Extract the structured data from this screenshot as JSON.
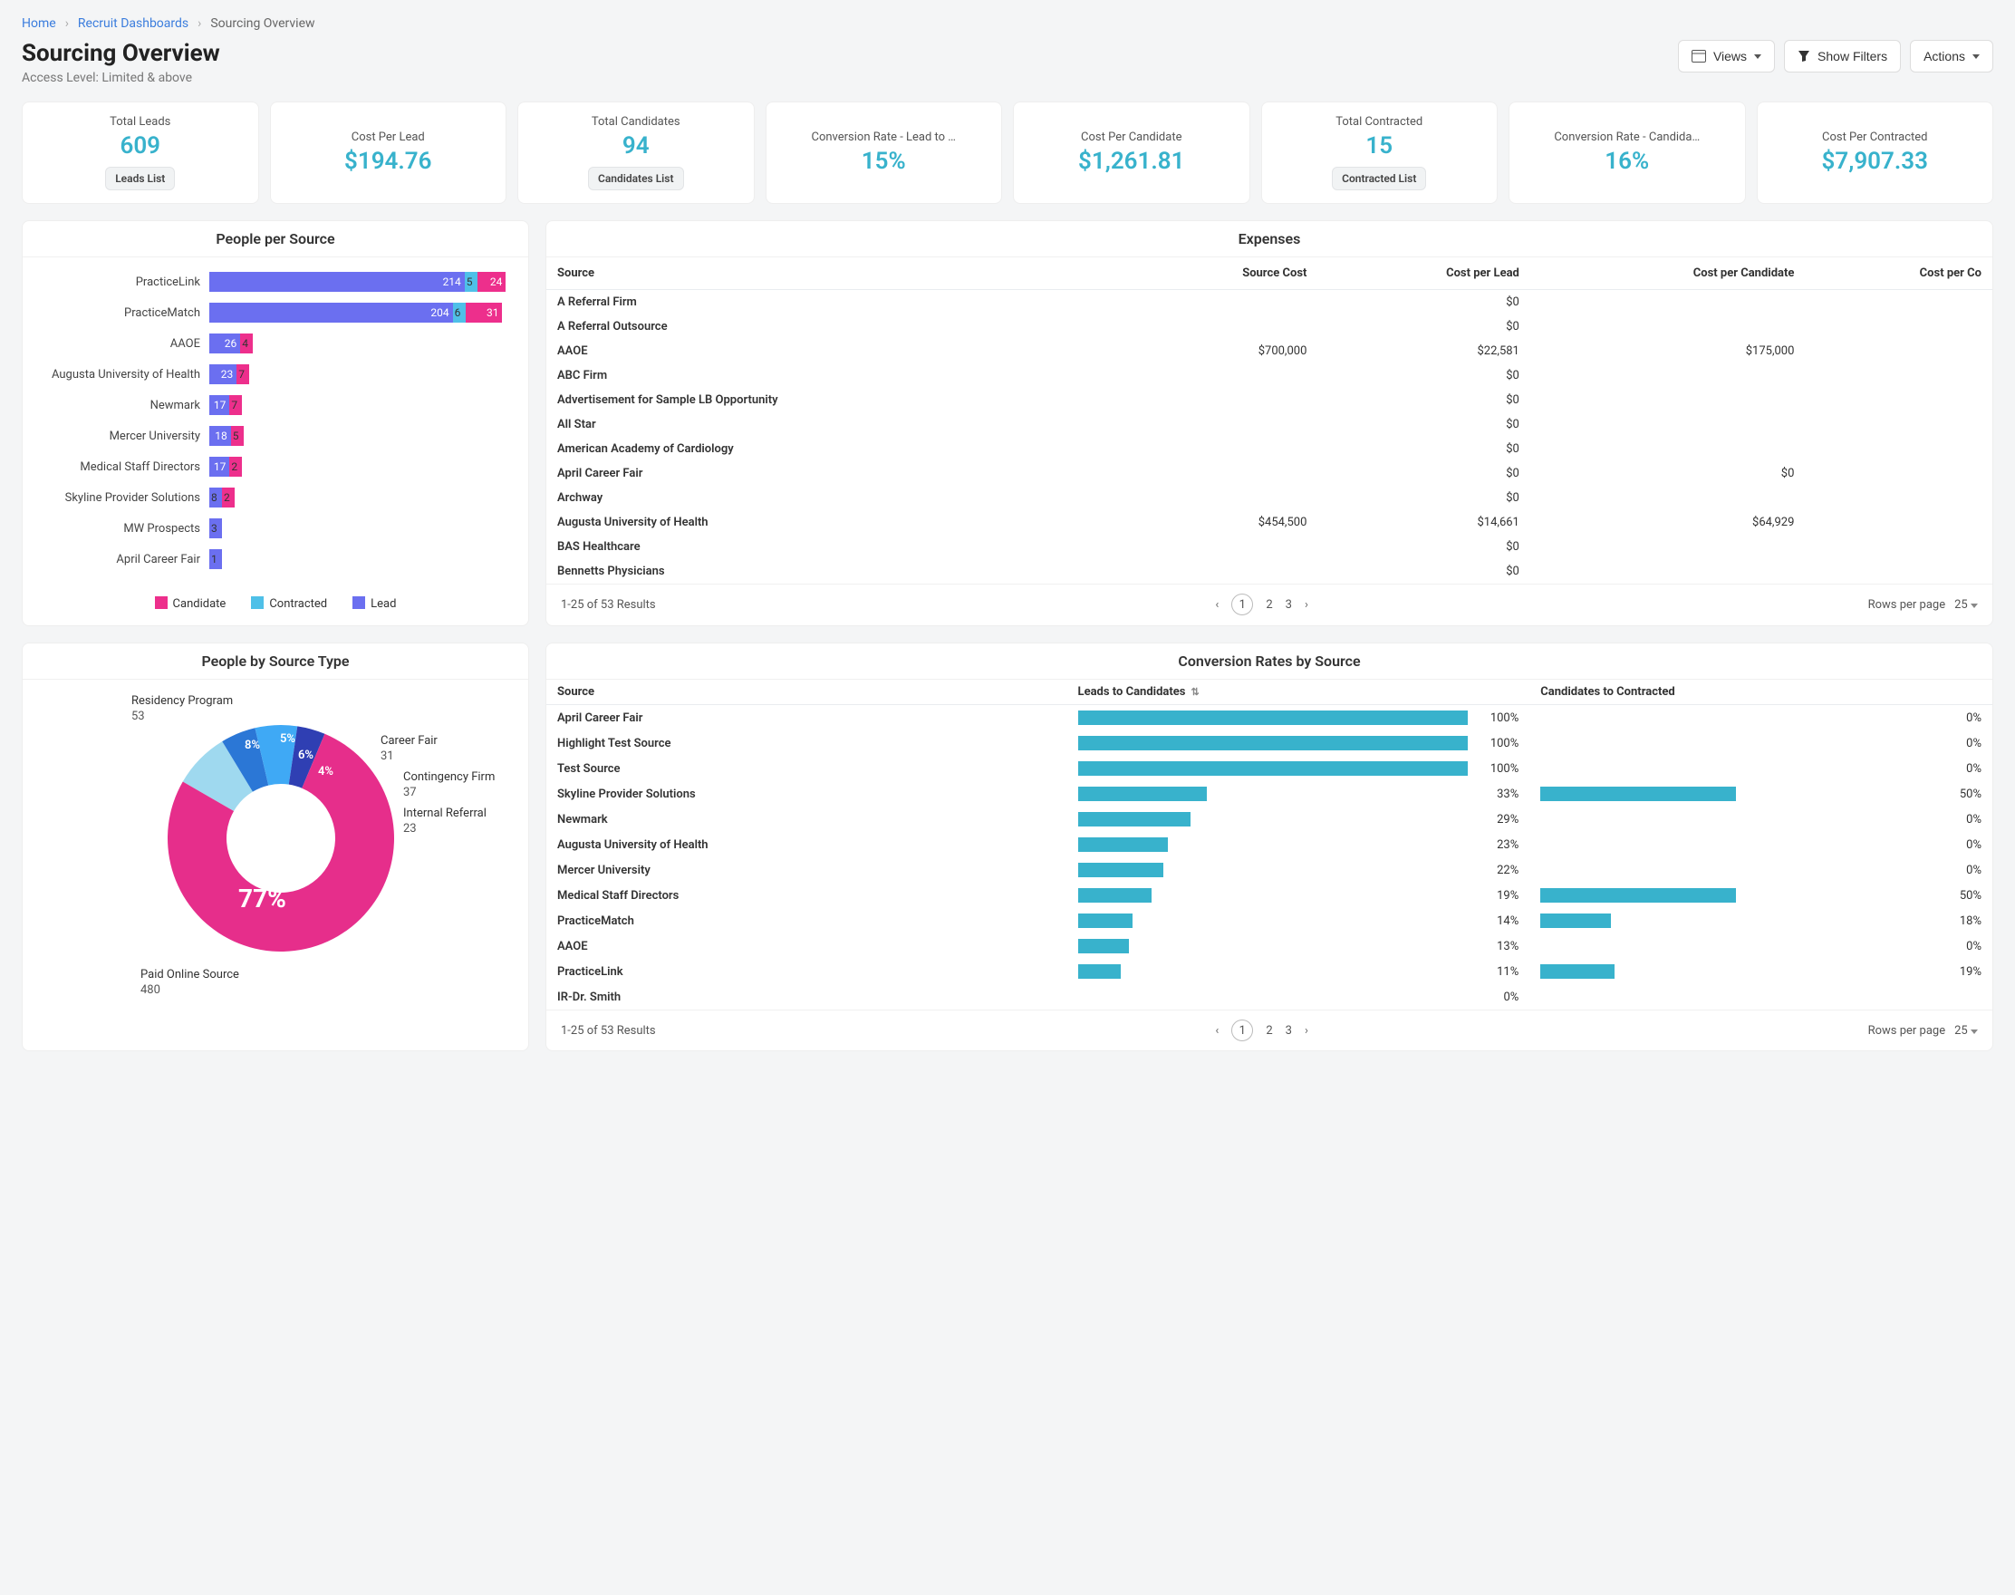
{
  "breadcrumbs": {
    "home": "Home",
    "dash": "Recruit Dashboards",
    "current": "Sourcing Overview"
  },
  "page": {
    "title": "Sourcing Overview",
    "subtitle": "Access Level: Limited & above"
  },
  "header_buttons": {
    "views": "Views",
    "show_filters": "Show Filters",
    "actions": "Actions"
  },
  "kpis": [
    {
      "label": "Total Leads",
      "value": "609",
      "pill": "Leads List"
    },
    {
      "label": "Cost Per Lead",
      "value": "$194.76"
    },
    {
      "label": "Total Candidates",
      "value": "94",
      "pill": "Candidates List"
    },
    {
      "label": "Conversion Rate - Lead to …",
      "value": "15%"
    },
    {
      "label": "Cost Per Candidate",
      "value": "$1,261.81"
    },
    {
      "label": "Total Contracted",
      "value": "15",
      "pill": "Contracted List"
    },
    {
      "label": "Conversion Rate - Candida…",
      "value": "16%"
    },
    {
      "label": "Cost Per Contracted",
      "value": "$7,907.33"
    }
  ],
  "pps": {
    "title": "People per Source",
    "legend": {
      "candidate": "Candidate",
      "contracted": "Contracted",
      "lead": "Lead"
    },
    "rows": [
      {
        "source": "PracticeLink",
        "lead": 214,
        "contracted": 5,
        "candidate": 24
      },
      {
        "source": "PracticeMatch",
        "lead": 204,
        "contracted": 6,
        "candidate": 31
      },
      {
        "source": "AAOE",
        "lead": 26,
        "contracted": null,
        "candidate": 4
      },
      {
        "source": "Augusta University of Health",
        "lead": 23,
        "contracted": null,
        "candidate": 7
      },
      {
        "source": "Newmark",
        "lead": 17,
        "contracted": null,
        "candidate": 7
      },
      {
        "source": "Mercer University",
        "lead": 18,
        "contracted": null,
        "candidate": 5
      },
      {
        "source": "Medical Staff Directors",
        "lead": 17,
        "contracted": null,
        "candidate": 2
      },
      {
        "source": "Skyline Provider Solutions",
        "lead": 8,
        "contracted": null,
        "candidate": 2
      },
      {
        "source": "MW Prospects",
        "lead": 3,
        "contracted": null,
        "candidate": null
      },
      {
        "source": "April Career Fair",
        "lead": 1,
        "contracted": null,
        "candidate": null
      }
    ]
  },
  "expenses": {
    "title": "Expenses",
    "columns": [
      "Source",
      "Source Cost",
      "Cost per Lead",
      "Cost per Candidate",
      "Cost per Co"
    ],
    "rows": [
      {
        "source": "A Referral Firm",
        "cost": "",
        "cpl": "$0",
        "cpc": ""
      },
      {
        "source": "A Referral Outsource",
        "cost": "",
        "cpl": "$0",
        "cpc": ""
      },
      {
        "source": "AAOE",
        "cost": "$700,000",
        "cpl": "$22,581",
        "cpc": "$175,000"
      },
      {
        "source": "ABC Firm",
        "cost": "",
        "cpl": "$0",
        "cpc": ""
      },
      {
        "source": "Advertisement for Sample LB Opportunity",
        "cost": "",
        "cpl": "$0",
        "cpc": ""
      },
      {
        "source": "All Star",
        "cost": "",
        "cpl": "$0",
        "cpc": ""
      },
      {
        "source": "American Academy of Cardiology",
        "cost": "",
        "cpl": "$0",
        "cpc": ""
      },
      {
        "source": "April Career Fair",
        "cost": "",
        "cpl": "$0",
        "cpc": "$0"
      },
      {
        "source": "Archway",
        "cost": "",
        "cpl": "$0",
        "cpc": ""
      },
      {
        "source": "Augusta University of Health",
        "cost": "$454,500",
        "cpl": "$14,661",
        "cpc": "$64,929"
      },
      {
        "source": "BAS Healthcare",
        "cost": "",
        "cpl": "$0",
        "cpc": ""
      },
      {
        "source": "Bennetts Physicians",
        "cost": "",
        "cpl": "$0",
        "cpc": ""
      }
    ],
    "footer": {
      "results": "1-25 of 53 Results",
      "pages": [
        "1",
        "2",
        "3"
      ],
      "rows_label": "Rows per page",
      "rows_value": "25"
    }
  },
  "donut": {
    "title": "People by Source Type",
    "center_pct": "77%",
    "slices": [
      {
        "name": "Paid Online Source",
        "count": 480,
        "pct": 77,
        "color": "#e62e8b"
      },
      {
        "name": "Residency Program",
        "count": 53,
        "pct": 8,
        "color": "#9fd9ef"
      },
      {
        "name": "Career Fair",
        "count": 31,
        "pct": 5,
        "color": "#2b77d6"
      },
      {
        "name": "Contingency Firm",
        "count": 37,
        "pct": 6,
        "color": "#3fa9f5"
      },
      {
        "name": "Internal Referral",
        "count": 23,
        "pct": 4,
        "color": "#2f3fb3"
      }
    ],
    "small_pcts": {
      "res": "8%",
      "cf": "5%",
      "contg": "6%",
      "ir": "4%"
    }
  },
  "conv": {
    "title": "Conversion Rates by Source",
    "columns": [
      "Source",
      "Leads to Candidates",
      "Candidates to Contracted"
    ],
    "rows": [
      {
        "source": "April Career Fair",
        "l2c": 100,
        "c2c": 0
      },
      {
        "source": "Highlight Test Source",
        "l2c": 100,
        "c2c": 0
      },
      {
        "source": "Test Source",
        "l2c": 100,
        "c2c": 0
      },
      {
        "source": "Skyline Provider Solutions",
        "l2c": 33,
        "c2c": 50
      },
      {
        "source": "Newmark",
        "l2c": 29,
        "c2c": 0
      },
      {
        "source": "Augusta University of Health",
        "l2c": 23,
        "c2c": 0
      },
      {
        "source": "Mercer University",
        "l2c": 22,
        "c2c": 0
      },
      {
        "source": "Medical Staff Directors",
        "l2c": 19,
        "c2c": 50
      },
      {
        "source": "PracticeMatch",
        "l2c": 14,
        "c2c": 18
      },
      {
        "source": "AAOE",
        "l2c": 13,
        "c2c": 0
      },
      {
        "source": "PracticeLink",
        "l2c": 11,
        "c2c": 19
      },
      {
        "source": "IR-Dr. Smith",
        "l2c": 0,
        "c2c": null
      }
    ],
    "footer": {
      "results": "1-25 of 53 Results",
      "pages": [
        "1",
        "2",
        "3"
      ],
      "rows_label": "Rows per page",
      "rows_value": "25"
    }
  },
  "chart_data": [
    {
      "type": "bar",
      "title": "People per Source",
      "orientation": "horizontal",
      "stacked": true,
      "categories": [
        "PracticeLink",
        "PracticeMatch",
        "AAOE",
        "Augusta University of Health",
        "Newmark",
        "Mercer University",
        "Medical Staff Directors",
        "Skyline Provider Solutions",
        "MW Prospects",
        "April Career Fair"
      ],
      "series": [
        {
          "name": "Lead",
          "color": "#6b6ff0",
          "values": [
            214,
            204,
            26,
            23,
            17,
            18,
            17,
            8,
            3,
            1
          ]
        },
        {
          "name": "Contracted",
          "color": "#4fc0e8",
          "values": [
            5,
            6,
            null,
            null,
            null,
            null,
            null,
            null,
            null,
            null
          ]
        },
        {
          "name": "Candidate",
          "color": "#ed2f8c",
          "values": [
            24,
            31,
            4,
            7,
            7,
            5,
            2,
            2,
            null,
            null
          ]
        }
      ]
    },
    {
      "type": "pie",
      "title": "People by Source Type",
      "donut": true,
      "series": [
        {
          "name": "Paid Online Source",
          "value": 480,
          "pct": 77,
          "color": "#e62e8b"
        },
        {
          "name": "Residency Program",
          "value": 53,
          "pct": 8,
          "color": "#9fd9ef"
        },
        {
          "name": "Career Fair",
          "value": 31,
          "pct": 5,
          "color": "#2b77d6"
        },
        {
          "name": "Contingency Firm",
          "value": 37,
          "pct": 6,
          "color": "#3fa9f5"
        },
        {
          "name": "Internal Referral",
          "value": 23,
          "pct": 4,
          "color": "#2f3fb3"
        }
      ]
    },
    {
      "type": "bar",
      "title": "Conversion Rates by Source",
      "orientation": "horizontal",
      "unit": "percent",
      "categories": [
        "April Career Fair",
        "Highlight Test Source",
        "Test Source",
        "Skyline Provider Solutions",
        "Newmark",
        "Augusta University of Health",
        "Mercer University",
        "Medical Staff Directors",
        "PracticeMatch",
        "AAOE",
        "PracticeLink",
        "IR-Dr. Smith"
      ],
      "series": [
        {
          "name": "Leads to Candidates",
          "values": [
            100,
            100,
            100,
            33,
            29,
            23,
            22,
            19,
            14,
            13,
            11,
            0
          ]
        },
        {
          "name": "Candidates to Contracted",
          "values": [
            0,
            0,
            0,
            50,
            0,
            0,
            0,
            50,
            18,
            0,
            19,
            null
          ]
        }
      ],
      "xlim": [
        0,
        100
      ]
    },
    {
      "type": "table",
      "title": "Expenses",
      "columns": [
        "Source",
        "Source Cost",
        "Cost per Lead",
        "Cost per Candidate"
      ],
      "rows": [
        [
          "A Referral Firm",
          null,
          0,
          null
        ],
        [
          "A Referral Outsource",
          null,
          0,
          null
        ],
        [
          "AAOE",
          700000,
          22581,
          175000
        ],
        [
          "ABC Firm",
          null,
          0,
          null
        ],
        [
          "Advertisement for Sample LB Opportunity",
          null,
          0,
          null
        ],
        [
          "All Star",
          null,
          0,
          null
        ],
        [
          "American Academy of Cardiology",
          null,
          0,
          null
        ],
        [
          "April Career Fair",
          null,
          0,
          0
        ],
        [
          "Archway",
          null,
          0,
          null
        ],
        [
          "Augusta University of Health",
          454500,
          14661,
          64929
        ],
        [
          "BAS Healthcare",
          null,
          0,
          null
        ],
        [
          "Bennetts Physicians",
          null,
          0,
          null
        ]
      ]
    }
  ]
}
